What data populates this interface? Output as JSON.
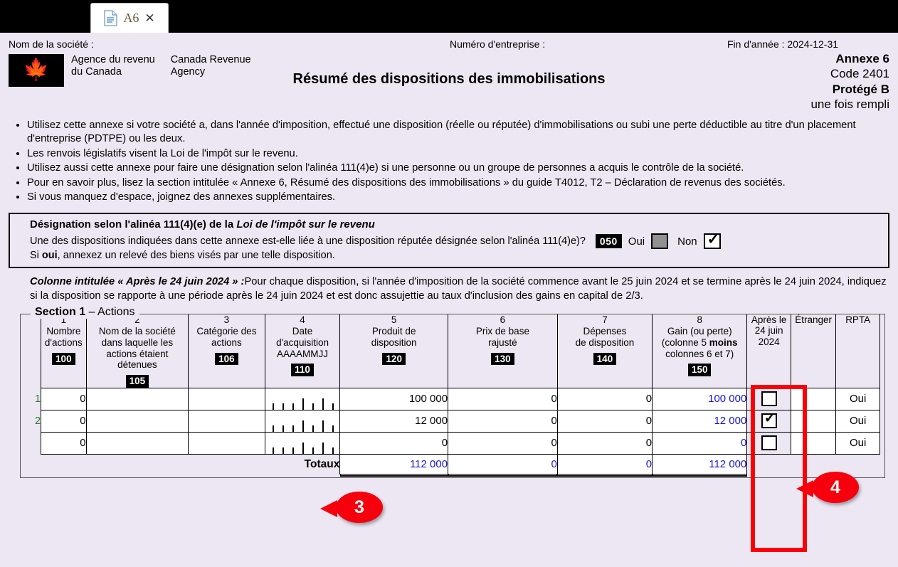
{
  "tab": {
    "label": "A6",
    "icon": "document-icon",
    "close": "✕"
  },
  "header": {
    "company_label": "Nom de la société :",
    "business_number_label": "Numéro d'entreprise :",
    "year_end_label": "Fin d'année : 2024-12-31",
    "agency_fr": [
      "Agence du revenu",
      "du Canada"
    ],
    "agency_en": [
      "Canada Revenue",
      "Agency"
    ],
    "title": "Résumé des dispositions des immobilisations",
    "schedule": "Annexe 6",
    "code": "Code 2401",
    "protected": "Protégé B",
    "protected_note": "une fois rempli"
  },
  "bullets": [
    "Utilisez cette annexe si votre société a, dans l'année d'imposition, effectué une disposition (réelle ou réputée) d'immobilisations ou subi une perte déductible au titre d'un placement d'entreprise (PDTPE) ou les deux.",
    "Les renvois législatifs visent la Loi de l'impôt sur le revenu.",
    "Utilisez aussi cette annexe pour faire une désignation selon l'alinéa 111(4)e) si une personne ou un groupe de personnes a acquis le contrôle de la société.",
    "Pour en savoir plus, lisez la section intitulée « Annexe 6, Résumé des dispositions des immobilisations » du guide T4012, T2 – Déclaration de revenus des sociétés.",
    "Si vous manquez d'espace, joignez des annexes supplémentaires."
  ],
  "designation": {
    "title_plain": "Désignation selon l'alinéa 111(4)(e) de la ",
    "title_italic": "Loi de l'impôt sur le revenu",
    "question": "Une des dispositions indiquées dans cette annexe est-elle liée à une disposition réputée désignée selon l'alinéa 111(4)e)?",
    "field_code": "050",
    "yes_label": "Oui",
    "yes_checked": false,
    "yes_disabled": true,
    "no_label": "Non",
    "no_checked": true,
    "note_prefix": "Si ",
    "note_bold": "oui",
    "note_suffix": ", annexez un relevé des biens visés par une telle disposition."
  },
  "column_note": {
    "lead": "Colonne intitulée « Après le 24 juin 2024 » :",
    "body": "Pour chaque disposition, si l'année d'imposition de la société commence avant le 25 juin 2024 et se termine après le 24 juin 2024, indiquez si la disposition se rapporte à une période après le 24 juin 2024 et est donc assujettie au taux d'inclusion des gains en capital de 2/3."
  },
  "section1": {
    "legend_bold": "Section 1",
    "legend_rest": " – Actions",
    "columns": [
      {
        "num": "1",
        "title": "Nombre\nd'actions",
        "code": "100"
      },
      {
        "num": "2",
        "title": "Nom de la société\ndans laquelle les\nactions étaient\ndétenues",
        "code": "105"
      },
      {
        "num": "3",
        "title": "Catégorie des\nactions",
        "code": "106"
      },
      {
        "num": "4",
        "title": "Date\nd'acquisition\nAAAAMMJJ",
        "code": "110"
      },
      {
        "num": "5",
        "title": "Produit de\ndisposition",
        "code": "120"
      },
      {
        "num": "6",
        "title": "Prix de base\nrajusté",
        "code": "130"
      },
      {
        "num": "7",
        "title": "Dépenses\nde disposition",
        "code": "140"
      },
      {
        "num": "8",
        "title": "Gain (ou perte)\n(colonne 5 moins\ncolonnes 6 et 7)",
        "code": "150"
      },
      {
        "num": "",
        "title": "Après le\n24 juin\n2024",
        "code": ""
      },
      {
        "num": "",
        "title": "Étranger",
        "code": ""
      },
      {
        "num": "",
        "title": "RPTA",
        "code": ""
      }
    ],
    "rows": [
      {
        "index": "1",
        "shares": "0",
        "company": "",
        "category": "",
        "date": "",
        "proceeds": "100 000",
        "acb": "0",
        "expenses": "0",
        "gain": "100 000",
        "after_june": false,
        "foreign": "",
        "rpta": "Oui"
      },
      {
        "index": "2",
        "shares": "0",
        "company": "",
        "category": "",
        "date": "",
        "proceeds": "12 000",
        "acb": "0",
        "expenses": "0",
        "gain": "12 000",
        "after_june": true,
        "foreign": "",
        "rpta": "Oui"
      },
      {
        "index": "",
        "shares": "0",
        "company": "",
        "category": "",
        "date": "",
        "proceeds": "0",
        "acb": "0",
        "expenses": "0",
        "gain": "0",
        "after_june": false,
        "foreign": "",
        "rpta": "Oui"
      }
    ],
    "totals": {
      "label": "Totaux",
      "proceeds": "112 000",
      "acb": "0",
      "expenses": "0",
      "gain": "112 000"
    }
  },
  "annotations": [
    {
      "id": "3",
      "label": "3"
    },
    {
      "id": "4",
      "label": "4"
    }
  ],
  "colors": {
    "page_bg": "#ece7f2",
    "accent_red": "#f5000c",
    "value_blue": "#1414d6",
    "row_index_green": "#2e7d32"
  }
}
